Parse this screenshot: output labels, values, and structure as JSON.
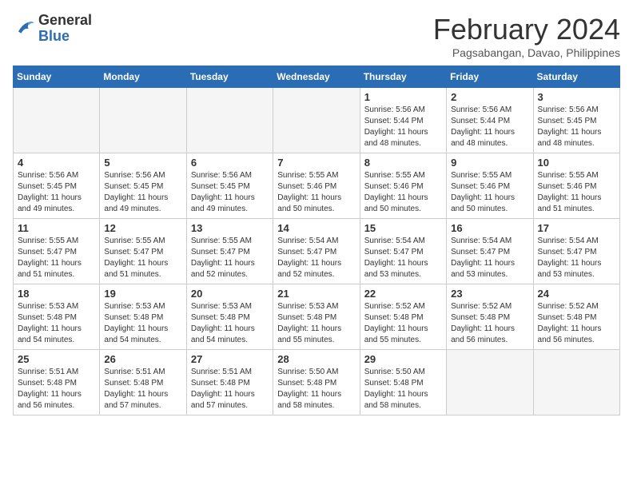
{
  "header": {
    "logo_general": "General",
    "logo_blue": "Blue",
    "month_title": "February 2024",
    "location": "Pagsabangan, Davao, Philippines"
  },
  "days_of_week": [
    "Sunday",
    "Monday",
    "Tuesday",
    "Wednesday",
    "Thursday",
    "Friday",
    "Saturday"
  ],
  "weeks": [
    [
      {
        "day": "",
        "empty": true
      },
      {
        "day": "",
        "empty": true
      },
      {
        "day": "",
        "empty": true
      },
      {
        "day": "",
        "empty": true
      },
      {
        "day": "1",
        "sunrise": "5:56 AM",
        "sunset": "5:44 PM",
        "daylight": "11 hours and 48 minutes."
      },
      {
        "day": "2",
        "sunrise": "5:56 AM",
        "sunset": "5:44 PM",
        "daylight": "11 hours and 48 minutes."
      },
      {
        "day": "3",
        "sunrise": "5:56 AM",
        "sunset": "5:45 PM",
        "daylight": "11 hours and 48 minutes."
      }
    ],
    [
      {
        "day": "4",
        "sunrise": "5:56 AM",
        "sunset": "5:45 PM",
        "daylight": "11 hours and 49 minutes."
      },
      {
        "day": "5",
        "sunrise": "5:56 AM",
        "sunset": "5:45 PM",
        "daylight": "11 hours and 49 minutes."
      },
      {
        "day": "6",
        "sunrise": "5:56 AM",
        "sunset": "5:45 PM",
        "daylight": "11 hours and 49 minutes."
      },
      {
        "day": "7",
        "sunrise": "5:55 AM",
        "sunset": "5:46 PM",
        "daylight": "11 hours and 50 minutes."
      },
      {
        "day": "8",
        "sunrise": "5:55 AM",
        "sunset": "5:46 PM",
        "daylight": "11 hours and 50 minutes."
      },
      {
        "day": "9",
        "sunrise": "5:55 AM",
        "sunset": "5:46 PM",
        "daylight": "11 hours and 50 minutes."
      },
      {
        "day": "10",
        "sunrise": "5:55 AM",
        "sunset": "5:46 PM",
        "daylight": "11 hours and 51 minutes."
      }
    ],
    [
      {
        "day": "11",
        "sunrise": "5:55 AM",
        "sunset": "5:47 PM",
        "daylight": "11 hours and 51 minutes."
      },
      {
        "day": "12",
        "sunrise": "5:55 AM",
        "sunset": "5:47 PM",
        "daylight": "11 hours and 51 minutes."
      },
      {
        "day": "13",
        "sunrise": "5:55 AM",
        "sunset": "5:47 PM",
        "daylight": "11 hours and 52 minutes."
      },
      {
        "day": "14",
        "sunrise": "5:54 AM",
        "sunset": "5:47 PM",
        "daylight": "11 hours and 52 minutes."
      },
      {
        "day": "15",
        "sunrise": "5:54 AM",
        "sunset": "5:47 PM",
        "daylight": "11 hours and 53 minutes."
      },
      {
        "day": "16",
        "sunrise": "5:54 AM",
        "sunset": "5:47 PM",
        "daylight": "11 hours and 53 minutes."
      },
      {
        "day": "17",
        "sunrise": "5:54 AM",
        "sunset": "5:47 PM",
        "daylight": "11 hours and 53 minutes."
      }
    ],
    [
      {
        "day": "18",
        "sunrise": "5:53 AM",
        "sunset": "5:48 PM",
        "daylight": "11 hours and 54 minutes."
      },
      {
        "day": "19",
        "sunrise": "5:53 AM",
        "sunset": "5:48 PM",
        "daylight": "11 hours and 54 minutes."
      },
      {
        "day": "20",
        "sunrise": "5:53 AM",
        "sunset": "5:48 PM",
        "daylight": "11 hours and 54 minutes."
      },
      {
        "day": "21",
        "sunrise": "5:53 AM",
        "sunset": "5:48 PM",
        "daylight": "11 hours and 55 minutes."
      },
      {
        "day": "22",
        "sunrise": "5:52 AM",
        "sunset": "5:48 PM",
        "daylight": "11 hours and 55 minutes."
      },
      {
        "day": "23",
        "sunrise": "5:52 AM",
        "sunset": "5:48 PM",
        "daylight": "11 hours and 56 minutes."
      },
      {
        "day": "24",
        "sunrise": "5:52 AM",
        "sunset": "5:48 PM",
        "daylight": "11 hours and 56 minutes."
      }
    ],
    [
      {
        "day": "25",
        "sunrise": "5:51 AM",
        "sunset": "5:48 PM",
        "daylight": "11 hours and 56 minutes."
      },
      {
        "day": "26",
        "sunrise": "5:51 AM",
        "sunset": "5:48 PM",
        "daylight": "11 hours and 57 minutes."
      },
      {
        "day": "27",
        "sunrise": "5:51 AM",
        "sunset": "5:48 PM",
        "daylight": "11 hours and 57 minutes."
      },
      {
        "day": "28",
        "sunrise": "5:50 AM",
        "sunset": "5:48 PM",
        "daylight": "11 hours and 58 minutes."
      },
      {
        "day": "29",
        "sunrise": "5:50 AM",
        "sunset": "5:48 PM",
        "daylight": "11 hours and 58 minutes."
      },
      {
        "day": "",
        "empty": true
      },
      {
        "day": "",
        "empty": true
      }
    ]
  ]
}
